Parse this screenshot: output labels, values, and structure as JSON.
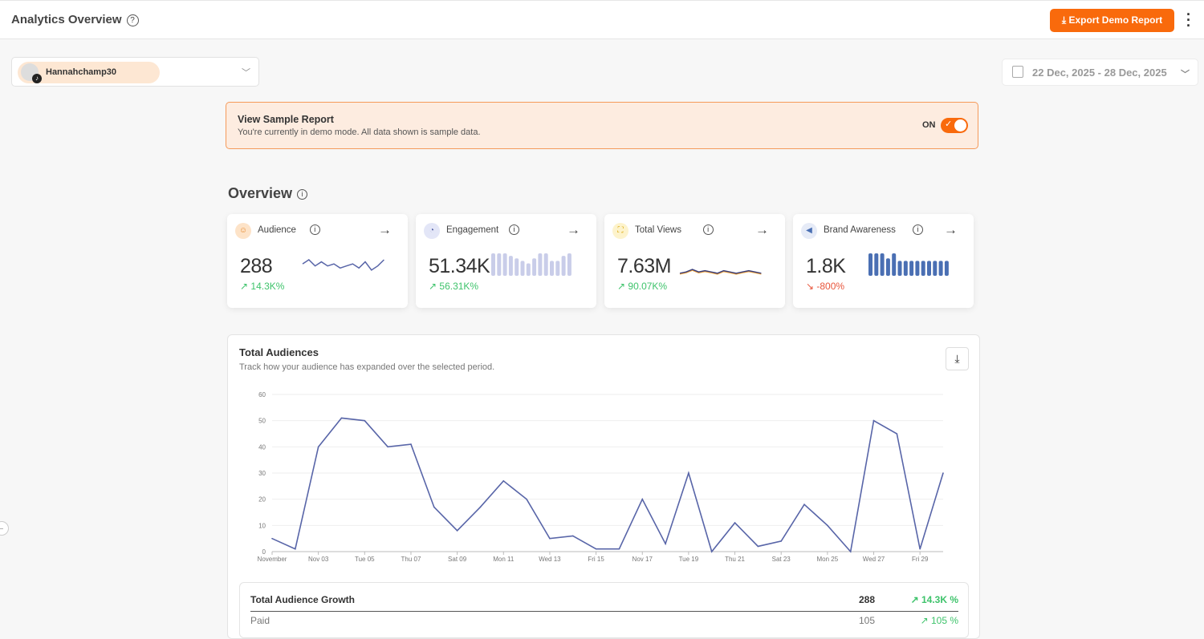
{
  "header": {
    "title": "Analytics Overview",
    "export_label": "Export Demo Report"
  },
  "account": {
    "name": "Hannahchamp30"
  },
  "date_range": "22 Dec, 2025 - 28 Dec, 2025",
  "banner": {
    "title": "View Sample Report",
    "text": "You're currently in demo mode. All data shown is sample data.",
    "toggle_label": "ON",
    "toggle_on": true
  },
  "overview": {
    "title": "Overview",
    "cards": [
      {
        "label": "Audience",
        "value": "288",
        "change": "14.3K%",
        "trend": "up",
        "color": "#3ec36b",
        "spark": [
          5,
          7,
          4,
          6,
          4,
          5,
          3,
          4,
          5,
          3,
          6,
          2,
          4,
          7
        ]
      },
      {
        "label": "Engagement",
        "value": "51.34K",
        "change": "56.31K%",
        "trend": "up",
        "color": "#3ec36b",
        "spark": [
          9,
          9,
          9,
          8,
          7,
          6,
          5,
          7,
          9,
          9,
          6,
          6,
          8,
          9
        ]
      },
      {
        "label": "Total Views",
        "value": "7.63M",
        "change": "90.07K%",
        "trend": "up",
        "color": "#3ec36b",
        "spark": [
          2,
          3,
          5,
          3,
          4,
          3,
          2,
          4,
          3,
          2,
          3,
          4,
          3,
          2
        ]
      },
      {
        "label": "Brand Awareness",
        "value": "1.8K",
        "change": "-800%",
        "trend": "down",
        "color": "#e8553b",
        "spark": [
          9,
          9,
          9,
          7,
          9,
          6,
          6,
          6,
          6,
          6,
          6,
          6,
          6,
          6
        ]
      }
    ]
  },
  "panel": {
    "title": "Total Audiences",
    "subtitle": "Track how your audience has expanded over the selected period."
  },
  "chart_data": {
    "type": "line",
    "title": "Total Audiences",
    "ylim": [
      0,
      60
    ],
    "yticks": [
      0,
      10,
      20,
      30,
      40,
      50,
      60
    ],
    "x": [
      "Nov 01",
      "Nov 02",
      "Nov 03",
      "Nov 04",
      "Nov 05",
      "Nov 06",
      "Nov 07",
      "Nov 08",
      "Nov 09",
      "Nov 10",
      "Nov 11",
      "Nov 12",
      "Nov 13",
      "Nov 14",
      "Nov 15",
      "Nov 16",
      "Nov 17",
      "Nov 18",
      "Nov 19",
      "Nov 20",
      "Nov 21",
      "Nov 22",
      "Nov 23",
      "Nov 24",
      "Nov 25",
      "Nov 26",
      "Nov 27",
      "Nov 28",
      "Nov 29",
      "Nov 30"
    ],
    "xtick_labels": [
      "November",
      "Nov 03",
      "Tue 05",
      "Thu 07",
      "Sat 09",
      "Mon 11",
      "Wed 13",
      "Fri 15",
      "Nov 17",
      "Tue 19",
      "Thu 21",
      "Sat 23",
      "Mon 25",
      "Wed 27",
      "Fri 29"
    ],
    "values": [
      5,
      1,
      40,
      51,
      50,
      40,
      41,
      17,
      8,
      17,
      27,
      20,
      5,
      6,
      1,
      1,
      20,
      3,
      30,
      0,
      11,
      2,
      4,
      18,
      10,
      0,
      50,
      45,
      1,
      30
    ],
    "color": "#5865a8"
  },
  "growth": {
    "rows": [
      {
        "name": "Total Audience Growth",
        "value": "288",
        "change": "14.3K %"
      },
      {
        "name": "Paid",
        "value": "105",
        "change": "105 %"
      }
    ]
  }
}
